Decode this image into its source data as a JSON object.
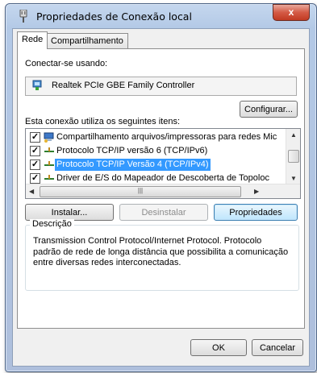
{
  "window": {
    "title": "Propriedades de Conexão local",
    "close_label": "x"
  },
  "tabs": [
    {
      "label": "Rede"
    },
    {
      "label": "Compartilhamento"
    }
  ],
  "connect_using": {
    "label": "Conectar-se usando:",
    "adapter": "Realtek PCIe GBE Family Controller"
  },
  "buttons": {
    "configure": "Configurar...",
    "install": "Instalar...",
    "uninstall": "Desinstalar",
    "properties": "Propriedades",
    "ok": "OK",
    "cancel": "Cancelar"
  },
  "items_label": "Esta conexão utiliza os seguintes itens:",
  "items": [
    {
      "label": "Compartilhamento arquivos/impressoras para redes Mic",
      "checked": true,
      "selected": false,
      "icon": "share-icon"
    },
    {
      "label": "Protocolo TCP/IP versão 6 (TCP/IPv6)",
      "checked": true,
      "selected": false,
      "icon": "protocol-icon"
    },
    {
      "label": "Protocolo TCP/IP Versão 4 (TCP/IPv4)",
      "checked": true,
      "selected": true,
      "icon": "protocol-icon"
    },
    {
      "label": "Driver de E/S do Mapeador de Descoberta de Topoloc",
      "checked": true,
      "selected": false,
      "icon": "protocol-icon"
    }
  ],
  "description": {
    "title": "Descrição",
    "text": "Transmission Control Protocol/Internet Protocol. Protocolo padrão de rede de longa distância que possibilita a comunicação entre diversas redes interconectadas."
  },
  "colors": {
    "selection": "#3399ff",
    "title_bar": "#b9cde8",
    "close_button": "#c8432c"
  }
}
